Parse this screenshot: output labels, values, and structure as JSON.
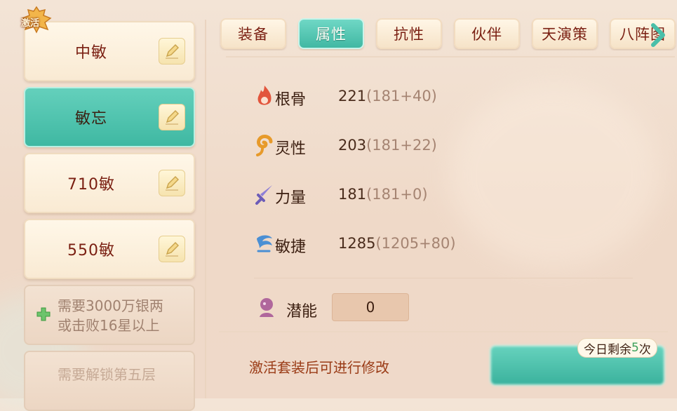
{
  "presets": [
    {
      "label": "中敏",
      "activated_badge": "激活",
      "state": "normal"
    },
    {
      "label": "敏忘",
      "state": "active"
    },
    {
      "label": "710敏",
      "state": "normal"
    },
    {
      "label": "550敏",
      "state": "normal"
    }
  ],
  "locked_slots": [
    {
      "line1": "需要3000万银两",
      "line2": "或击败16星以上"
    },
    {
      "line1": "需要解锁第五层",
      "line2": ""
    }
  ],
  "tabs": [
    {
      "label": "装备",
      "active": false
    },
    {
      "label": "属性",
      "active": true
    },
    {
      "label": "抗性",
      "active": false
    },
    {
      "label": "伙伴",
      "active": false
    },
    {
      "label": "天演策",
      "active": false
    },
    {
      "label": "八阵图",
      "active": false
    }
  ],
  "attributes": [
    {
      "name": "根骨",
      "total": "221",
      "detail": "(181+40)",
      "icon": "flame-icon"
    },
    {
      "name": "灵性",
      "total": "203",
      "detail": "(181+22)",
      "icon": "swirl-icon"
    },
    {
      "name": "力量",
      "total": "181",
      "detail": "(181+0)",
      "icon": "sword-icon"
    },
    {
      "name": "敏捷",
      "total": "1285",
      "detail": "(1205+80)",
      "icon": "wind-icon"
    }
  ],
  "potential": {
    "label": "潜能",
    "value": "0"
  },
  "hint": "激活套装后可进行修改",
  "confirm_button": "",
  "remaining": {
    "prefix": "今日剩余",
    "count": "5",
    "suffix": "次"
  },
  "colors": {
    "accent": "#41b8a3",
    "title_text": "#7a1f12",
    "hint_text": "#9a3b16"
  }
}
